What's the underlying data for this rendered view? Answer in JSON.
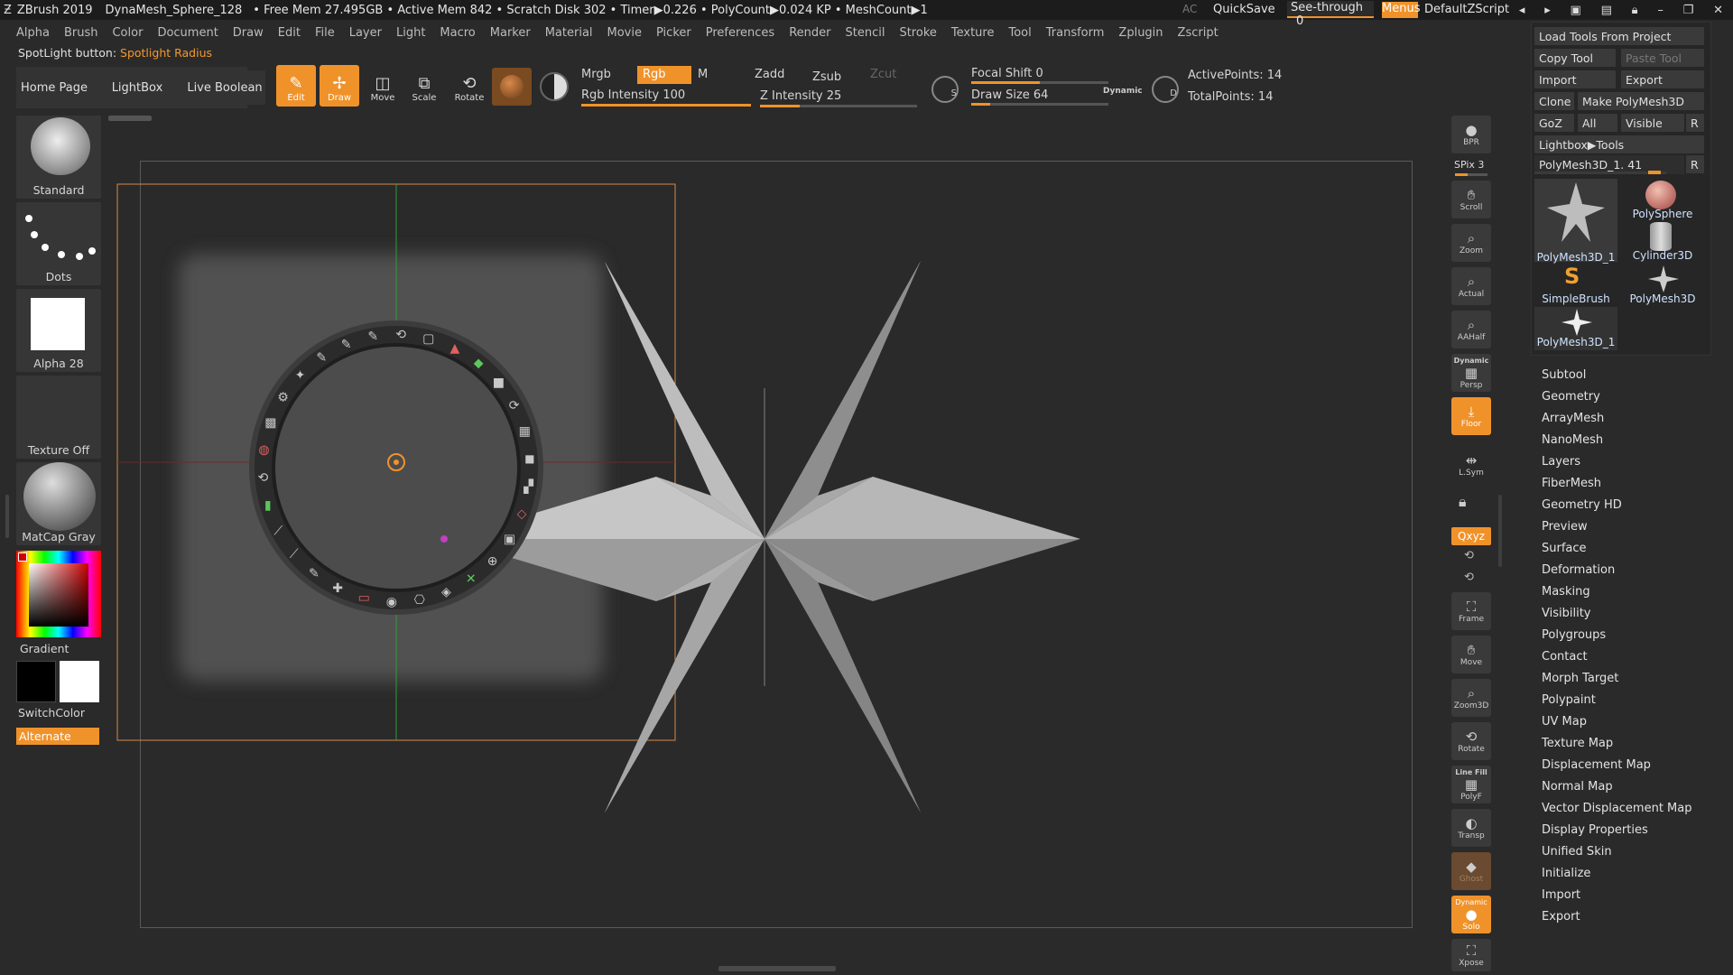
{
  "titlebar": {
    "app": "ZBrush 2019",
    "doc": "DynaMesh_Sphere_128",
    "stats": "• Free Mem 27.495GB • Active Mem 842 • Scratch Disk 302 • Timer▶0.226 • PolyCount▶0.024 KP • MeshCount▶1",
    "ac": "AC",
    "quicksave": "QuickSave",
    "seethrough": "See-through",
    "seethrough_val": "0",
    "menus": "Menus",
    "script": "DefaultZScript"
  },
  "menus": [
    "Alpha",
    "Brush",
    "Color",
    "Document",
    "Draw",
    "Edit",
    "File",
    "Layer",
    "Light",
    "Macro",
    "Marker",
    "Material",
    "Movie",
    "Picker",
    "Preferences",
    "Render",
    "Stencil",
    "Stroke",
    "Texture",
    "Tool",
    "Transform",
    "Zplugin",
    "Zscript"
  ],
  "spotlight": {
    "label": "SpotLight button:",
    "value": "Spotlight Radius"
  },
  "toolbar": {
    "home": "Home Page",
    "lightbox": "LightBox",
    "liveboolean": "Live Boolean",
    "edit": "Edit",
    "draw": "Draw",
    "move": "Move",
    "scale": "Scale",
    "rotate": "Rotate",
    "mrgb": "Mrgb",
    "rgb": "Rgb",
    "m": "M",
    "rgb_intensity": "Rgb Intensity 100",
    "zadd": "Zadd",
    "zsub": "Zsub",
    "zcut": "Zcut",
    "z_intensity": "Z Intensity 25",
    "focal_shift": "Focal Shift 0",
    "draw_size": "Draw Size 64",
    "dynamic": "Dynamic",
    "active_points": "ActivePoints: 14",
    "total_points": "TotalPoints: 14"
  },
  "levels": {
    "rgb_intensity": 1.0,
    "z_intensity": 0.25,
    "focal_shift": 0.5,
    "draw_size": 0.14
  },
  "shelf": {
    "brush": "Standard",
    "stroke": "Dots",
    "alpha": "Alpha 28",
    "texture": "Texture Off",
    "material": "MatCap Gray",
    "gradient": "Gradient",
    "switchcolor": "SwitchColor",
    "alternate": "Alternate"
  },
  "dock": {
    "bpr": "BPR",
    "spix": "SPix 3",
    "scroll": "Scroll",
    "zoom": "Zoom",
    "actual": "Actual",
    "aahalf": "AAHalf",
    "dynamic": "Dynamic",
    "persp": "Persp",
    "floor": "Floor",
    "lsym": "L.Sym",
    "xyz": "Qxyz",
    "frame": "Frame",
    "move": "Move",
    "zoom3d": "Zoom3D",
    "rotate": "Rotate",
    "linefill": "Line Fill",
    "polyf": "PolyF",
    "transp": "Transp",
    "ghost": "Ghost",
    "solo": "Solo",
    "dynamic2": "Dynamic",
    "xpose": "Xpose"
  },
  "toolpanel": {
    "load": "Load Tools From Project",
    "copy": "Copy Tool",
    "paste": "Paste Tool",
    "import": "Import",
    "export": "Export",
    "clone": "Clone",
    "make": "Make PolyMesh3D",
    "goz": "GoZ",
    "all": "All",
    "visible": "Visible",
    "r": "R",
    "lightbox_tools": "Lightbox▶Tools",
    "current": "PolyMesh3D_1. 41",
    "thumbs": [
      "PolyMesh3D_1",
      "PolySphere",
      "Cylinder3D",
      "SimpleBrush",
      "PolyMesh3D",
      "PolyMesh3D_1"
    ]
  },
  "subpalettes": [
    "Subtool",
    "Geometry",
    "ArrayMesh",
    "NanoMesh",
    "Layers",
    "FiberMesh",
    "Geometry HD",
    "Preview",
    "Surface",
    "Deformation",
    "Masking",
    "Visibility",
    "Polygroups",
    "Contact",
    "Morph Target",
    "Polypaint",
    "UV Map",
    "Texture Map",
    "Displacement Map",
    "Normal Map",
    "Vector Displacement Map",
    "Display Properties",
    "Unified Skin",
    "Initialize",
    "Import",
    "Export"
  ],
  "colors": {
    "accent": "#f0922a",
    "panel": "#363636",
    "bg": "#2a2a2a"
  }
}
